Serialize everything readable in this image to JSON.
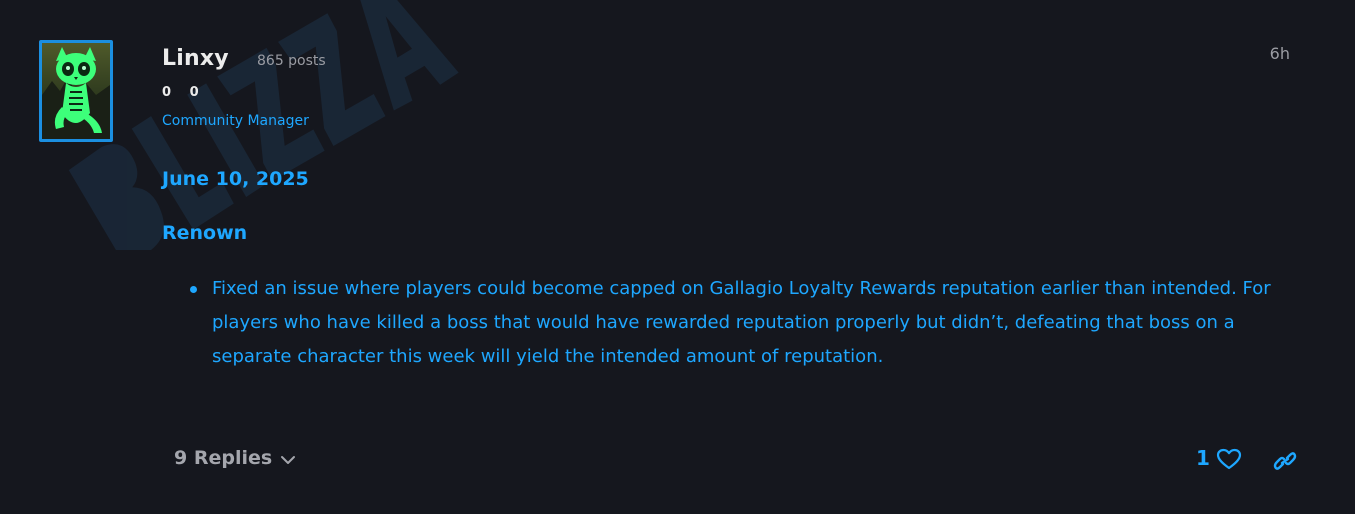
{
  "author": {
    "username": "Linxy",
    "post_count": "865 posts",
    "stat_1": "0",
    "stat_2": "0",
    "role": "Community Manager"
  },
  "post": {
    "timestamp": "6h",
    "date_heading": "June 10, 2025",
    "section_heading": "Renown",
    "bullets": [
      "Fixed an issue where players could become capped on Gallagio Loyalty Rewards reputation earlier than intended. For players who have killed a boss that would have rewarded reputation properly but didn’t, defeating that boss on a separate character this week will yield the intended amount of reputation."
    ]
  },
  "footer": {
    "replies_label": "9 Replies",
    "like_count": "1",
    "icons": {
      "replies": "chevron-down-icon",
      "like": "heart-icon",
      "share": "link-icon"
    }
  },
  "colors": {
    "background": "#15171e",
    "accent": "#1ea7ff",
    "muted": "#9a9ca3",
    "avatar_border": "#1b8fe0"
  }
}
